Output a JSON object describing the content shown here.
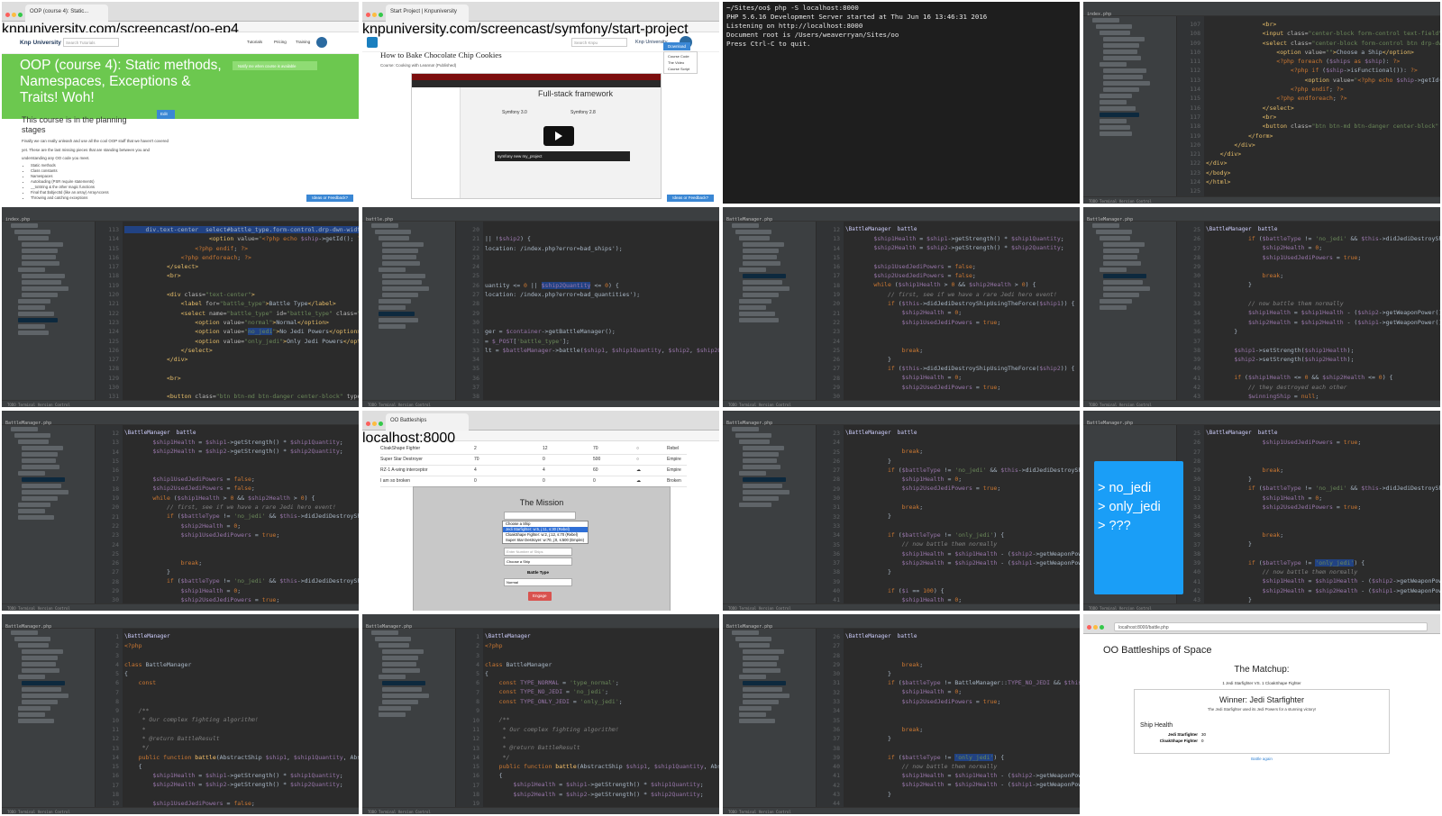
{
  "t1": {
    "tab": "OOP (course 4): Static...",
    "url": "knpuniversity.com/screencast/oo-ep4",
    "logo": "Knp University",
    "search_placeholder": "Search Tutorials",
    "nav": [
      "Tutorials",
      "Pricing",
      "Training"
    ],
    "hero_title": "OOP (course 4): Static methods, Namespaces, Exceptions & Traits! Woh!",
    "notify": "Notify me when course is available",
    "planning_title": "This course is in the planning stages",
    "edit": "Edit",
    "para": "Finally we can really unleash and use all the cool OOP stuff that we haven't covered yet. These are the last missing pieces that are standing between you and understanding any OO code you meet.",
    "bullets": [
      "Static methods",
      "Class constants",
      "Namespaces",
      "Autoloading (PSR require statements)",
      "__toString & the other magic functions",
      "Final that $objectId (like an array) ArrayAccess",
      "Throwing and catching exceptions"
    ],
    "feedback": "Ideas or Feedback?"
  },
  "t2": {
    "tab": "Start Project | Knpuniversity",
    "url": "knpuniversity.com/screencast/symfony/start-project",
    "search_placeholder": "Search Knpu",
    "logo": "Knp University",
    "title": "How to Bake Chocolate Chip Cookies",
    "course": "Course: Cooking with Leanna! (Published)",
    "download": "Download",
    "menu": [
      "Course Code",
      "The Video",
      "Course Script"
    ],
    "video_heading": "Full-stack framework",
    "sf3": "Symfony 3.0",
    "sf2": "Symfony 2.8",
    "cmd": "symfony new my_project",
    "feedback": "Ideas or Feedback?"
  },
  "t3": {
    "lines": [
      "~/Sites/oo$ php -S localhost:8000",
      "PHP 5.6.16 Development Server started at Thu Jun 16 13:46:31 2016",
      "Listening on http://localhost:8000",
      "Document root is /Users/weaverryan/Sites/oo",
      "Press Ctrl-C to quit."
    ]
  },
  "t8": {
    "items": [
      "> no_jedi",
      "> only_jedi",
      "> ???"
    ]
  },
  "t10": {
    "tab": "OO Battleships",
    "url": "localhost:8000",
    "rows": [
      [
        "CloakShape Fighter",
        "2",
        "12",
        "70",
        "Rebel"
      ],
      [
        "Super Star Destroyer",
        "70",
        "0",
        "500",
        "Empire"
      ],
      [
        "RZ-1 A-wing interceptor",
        "4",
        "4",
        "60",
        "Empire"
      ],
      [
        "I am so broken",
        "0",
        "0",
        "0",
        "Broken"
      ]
    ],
    "mission": "The Mission",
    "dropdown": [
      "Choose a Ship",
      "Jedi Starfighter: w:5, j:11, s:30 (Rebel)",
      "CloakShape Fighter: w:2, j:12, s:70 (Rebel)",
      "Super Star Destroyer: w:70, j:0, s:500 (Empire)"
    ],
    "qty_placeholder": "Enter Number of Ships",
    "choose": "Choose a Ship",
    "battle_type": "Battle Type",
    "normal": "Normal",
    "engage": "Engage"
  },
  "t16": {
    "url": "localhost:8000/battle.php",
    "title": "OO Battleships of Space",
    "matchup": "The Matchup:",
    "vs": "1 Jedi Starfighter VS. 1 CloakShape Fighter",
    "winner": "Winner: Jedi Starfighter",
    "desc": "The Jedi Starfighter used its Jedi Powers for a stunning victory!",
    "health": "Ship Health",
    "ships": [
      [
        "Jedi Starfighter",
        "30"
      ],
      [
        "CloakShape Fighter",
        "0"
      ]
    ],
    "again": "Battle again"
  }
}
